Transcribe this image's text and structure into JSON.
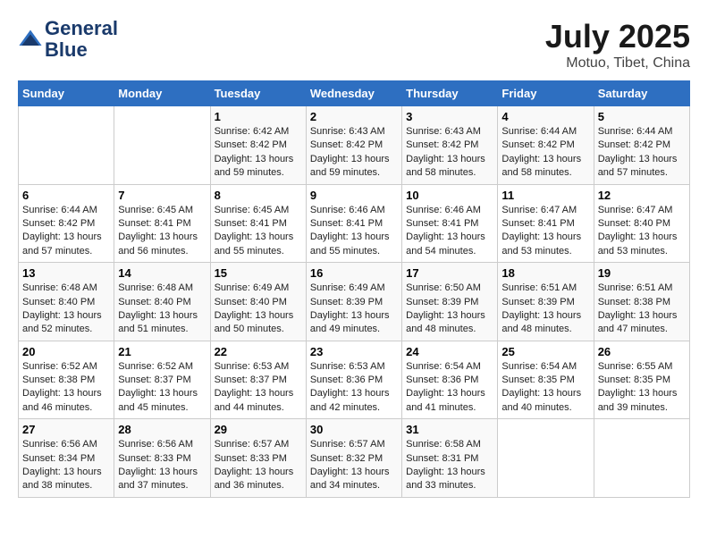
{
  "header": {
    "logo_line1": "General",
    "logo_line2": "Blue",
    "month_year": "July 2025",
    "location": "Motuo, Tibet, China"
  },
  "weekdays": [
    "Sunday",
    "Monday",
    "Tuesday",
    "Wednesday",
    "Thursday",
    "Friday",
    "Saturday"
  ],
  "weeks": [
    [
      {
        "day": "",
        "sunrise": "",
        "sunset": "",
        "daylight": ""
      },
      {
        "day": "",
        "sunrise": "",
        "sunset": "",
        "daylight": ""
      },
      {
        "day": "1",
        "sunrise": "Sunrise: 6:42 AM",
        "sunset": "Sunset: 8:42 PM",
        "daylight": "Daylight: 13 hours and 59 minutes."
      },
      {
        "day": "2",
        "sunrise": "Sunrise: 6:43 AM",
        "sunset": "Sunset: 8:42 PM",
        "daylight": "Daylight: 13 hours and 59 minutes."
      },
      {
        "day": "3",
        "sunrise": "Sunrise: 6:43 AM",
        "sunset": "Sunset: 8:42 PM",
        "daylight": "Daylight: 13 hours and 58 minutes."
      },
      {
        "day": "4",
        "sunrise": "Sunrise: 6:44 AM",
        "sunset": "Sunset: 8:42 PM",
        "daylight": "Daylight: 13 hours and 58 minutes."
      },
      {
        "day": "5",
        "sunrise": "Sunrise: 6:44 AM",
        "sunset": "Sunset: 8:42 PM",
        "daylight": "Daylight: 13 hours and 57 minutes."
      }
    ],
    [
      {
        "day": "6",
        "sunrise": "Sunrise: 6:44 AM",
        "sunset": "Sunset: 8:42 PM",
        "daylight": "Daylight: 13 hours and 57 minutes."
      },
      {
        "day": "7",
        "sunrise": "Sunrise: 6:45 AM",
        "sunset": "Sunset: 8:41 PM",
        "daylight": "Daylight: 13 hours and 56 minutes."
      },
      {
        "day": "8",
        "sunrise": "Sunrise: 6:45 AM",
        "sunset": "Sunset: 8:41 PM",
        "daylight": "Daylight: 13 hours and 55 minutes."
      },
      {
        "day": "9",
        "sunrise": "Sunrise: 6:46 AM",
        "sunset": "Sunset: 8:41 PM",
        "daylight": "Daylight: 13 hours and 55 minutes."
      },
      {
        "day": "10",
        "sunrise": "Sunrise: 6:46 AM",
        "sunset": "Sunset: 8:41 PM",
        "daylight": "Daylight: 13 hours and 54 minutes."
      },
      {
        "day": "11",
        "sunrise": "Sunrise: 6:47 AM",
        "sunset": "Sunset: 8:41 PM",
        "daylight": "Daylight: 13 hours and 53 minutes."
      },
      {
        "day": "12",
        "sunrise": "Sunrise: 6:47 AM",
        "sunset": "Sunset: 8:40 PM",
        "daylight": "Daylight: 13 hours and 53 minutes."
      }
    ],
    [
      {
        "day": "13",
        "sunrise": "Sunrise: 6:48 AM",
        "sunset": "Sunset: 8:40 PM",
        "daylight": "Daylight: 13 hours and 52 minutes."
      },
      {
        "day": "14",
        "sunrise": "Sunrise: 6:48 AM",
        "sunset": "Sunset: 8:40 PM",
        "daylight": "Daylight: 13 hours and 51 minutes."
      },
      {
        "day": "15",
        "sunrise": "Sunrise: 6:49 AM",
        "sunset": "Sunset: 8:40 PM",
        "daylight": "Daylight: 13 hours and 50 minutes."
      },
      {
        "day": "16",
        "sunrise": "Sunrise: 6:49 AM",
        "sunset": "Sunset: 8:39 PM",
        "daylight": "Daylight: 13 hours and 49 minutes."
      },
      {
        "day": "17",
        "sunrise": "Sunrise: 6:50 AM",
        "sunset": "Sunset: 8:39 PM",
        "daylight": "Daylight: 13 hours and 48 minutes."
      },
      {
        "day": "18",
        "sunrise": "Sunrise: 6:51 AM",
        "sunset": "Sunset: 8:39 PM",
        "daylight": "Daylight: 13 hours and 48 minutes."
      },
      {
        "day": "19",
        "sunrise": "Sunrise: 6:51 AM",
        "sunset": "Sunset: 8:38 PM",
        "daylight": "Daylight: 13 hours and 47 minutes."
      }
    ],
    [
      {
        "day": "20",
        "sunrise": "Sunrise: 6:52 AM",
        "sunset": "Sunset: 8:38 PM",
        "daylight": "Daylight: 13 hours and 46 minutes."
      },
      {
        "day": "21",
        "sunrise": "Sunrise: 6:52 AM",
        "sunset": "Sunset: 8:37 PM",
        "daylight": "Daylight: 13 hours and 45 minutes."
      },
      {
        "day": "22",
        "sunrise": "Sunrise: 6:53 AM",
        "sunset": "Sunset: 8:37 PM",
        "daylight": "Daylight: 13 hours and 44 minutes."
      },
      {
        "day": "23",
        "sunrise": "Sunrise: 6:53 AM",
        "sunset": "Sunset: 8:36 PM",
        "daylight": "Daylight: 13 hours and 42 minutes."
      },
      {
        "day": "24",
        "sunrise": "Sunrise: 6:54 AM",
        "sunset": "Sunset: 8:36 PM",
        "daylight": "Daylight: 13 hours and 41 minutes."
      },
      {
        "day": "25",
        "sunrise": "Sunrise: 6:54 AM",
        "sunset": "Sunset: 8:35 PM",
        "daylight": "Daylight: 13 hours and 40 minutes."
      },
      {
        "day": "26",
        "sunrise": "Sunrise: 6:55 AM",
        "sunset": "Sunset: 8:35 PM",
        "daylight": "Daylight: 13 hours and 39 minutes."
      }
    ],
    [
      {
        "day": "27",
        "sunrise": "Sunrise: 6:56 AM",
        "sunset": "Sunset: 8:34 PM",
        "daylight": "Daylight: 13 hours and 38 minutes."
      },
      {
        "day": "28",
        "sunrise": "Sunrise: 6:56 AM",
        "sunset": "Sunset: 8:33 PM",
        "daylight": "Daylight: 13 hours and 37 minutes."
      },
      {
        "day": "29",
        "sunrise": "Sunrise: 6:57 AM",
        "sunset": "Sunset: 8:33 PM",
        "daylight": "Daylight: 13 hours and 36 minutes."
      },
      {
        "day": "30",
        "sunrise": "Sunrise: 6:57 AM",
        "sunset": "Sunset: 8:32 PM",
        "daylight": "Daylight: 13 hours and 34 minutes."
      },
      {
        "day": "31",
        "sunrise": "Sunrise: 6:58 AM",
        "sunset": "Sunset: 8:31 PM",
        "daylight": "Daylight: 13 hours and 33 minutes."
      },
      {
        "day": "",
        "sunrise": "",
        "sunset": "",
        "daylight": ""
      },
      {
        "day": "",
        "sunrise": "",
        "sunset": "",
        "daylight": ""
      }
    ]
  ]
}
